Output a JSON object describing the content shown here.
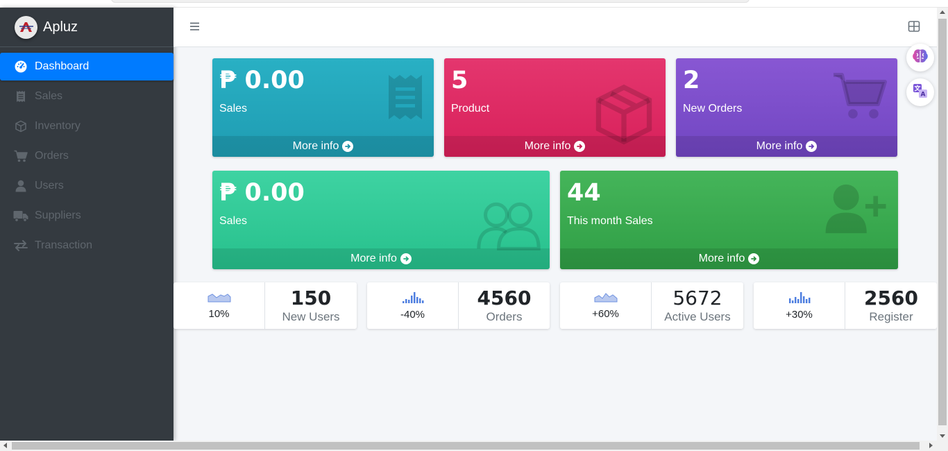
{
  "brand": {
    "name": "Apluz"
  },
  "sidebar": {
    "items": [
      {
        "label": "Dashboard",
        "icon": "tachometer-icon",
        "active": true
      },
      {
        "label": "Sales",
        "icon": "receipt-icon"
      },
      {
        "label": "Inventory",
        "icon": "box-icon"
      },
      {
        "label": "Orders",
        "icon": "cart-icon"
      },
      {
        "label": "Users",
        "icon": "user-icon"
      },
      {
        "label": "Suppliers",
        "icon": "truck-icon"
      },
      {
        "label": "Transaction",
        "icon": "exchange-icon"
      }
    ]
  },
  "boxes": {
    "sales_top": {
      "value": "₱ 0.00",
      "label": "Sales",
      "more": "More info",
      "color": "#1fa2b8"
    },
    "product": {
      "value": "5",
      "label": "Product",
      "more": "More info",
      "color": "#dc2a63"
    },
    "new_orders": {
      "value": "2",
      "label": "New Orders",
      "more": "More info",
      "color": "#7b4ec9"
    },
    "sales_bottom": {
      "value": "₱ 0.00",
      "label": "Sales",
      "more": "More info",
      "color": "#30c994"
    },
    "month_sales": {
      "value": "44",
      "label": "This month Sales",
      "more": "More info",
      "color": "#3aa94f"
    }
  },
  "stats": [
    {
      "pct": "10%",
      "value": "150",
      "caption": "New Users",
      "spark": "area"
    },
    {
      "pct": "-40%",
      "value": "4560",
      "caption": "Orders",
      "spark": "bars"
    },
    {
      "pct": "+60%",
      "value": "5672",
      "caption": "Active Users",
      "spark": "area"
    },
    {
      "pct": "+30%",
      "value": "2560",
      "caption": "Register",
      "spark": "bars"
    }
  ]
}
